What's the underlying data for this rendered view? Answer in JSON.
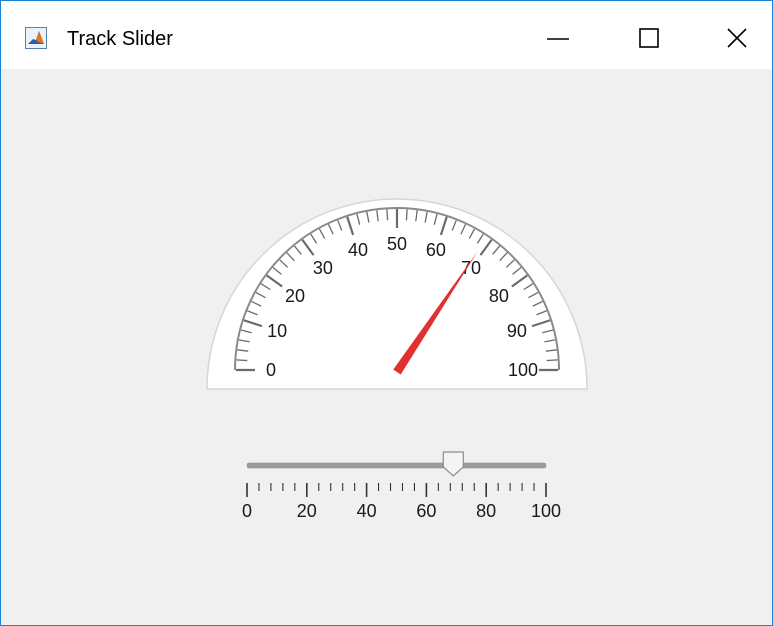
{
  "window": {
    "title": "Track Slider",
    "icon": "matlab-app-icon",
    "controls": [
      "minimize-icon",
      "maximize-icon",
      "close-icon"
    ]
  },
  "gauge": {
    "type": "semicircular",
    "min": 0,
    "max": 100,
    "value": 69,
    "major_ticks": [
      0,
      10,
      20,
      30,
      40,
      50,
      60,
      70,
      80,
      90,
      100
    ],
    "minor_ticks_per_major": 10,
    "needle_color": "#e0302f"
  },
  "slider": {
    "min": 0,
    "max": 100,
    "value": 69,
    "major_ticks": [
      0,
      20,
      40,
      60,
      80,
      100
    ],
    "minor_step": 4
  },
  "colors": {
    "window_border": "#1883d7",
    "background": "#f0f0f0",
    "needle": "#e0302f"
  }
}
